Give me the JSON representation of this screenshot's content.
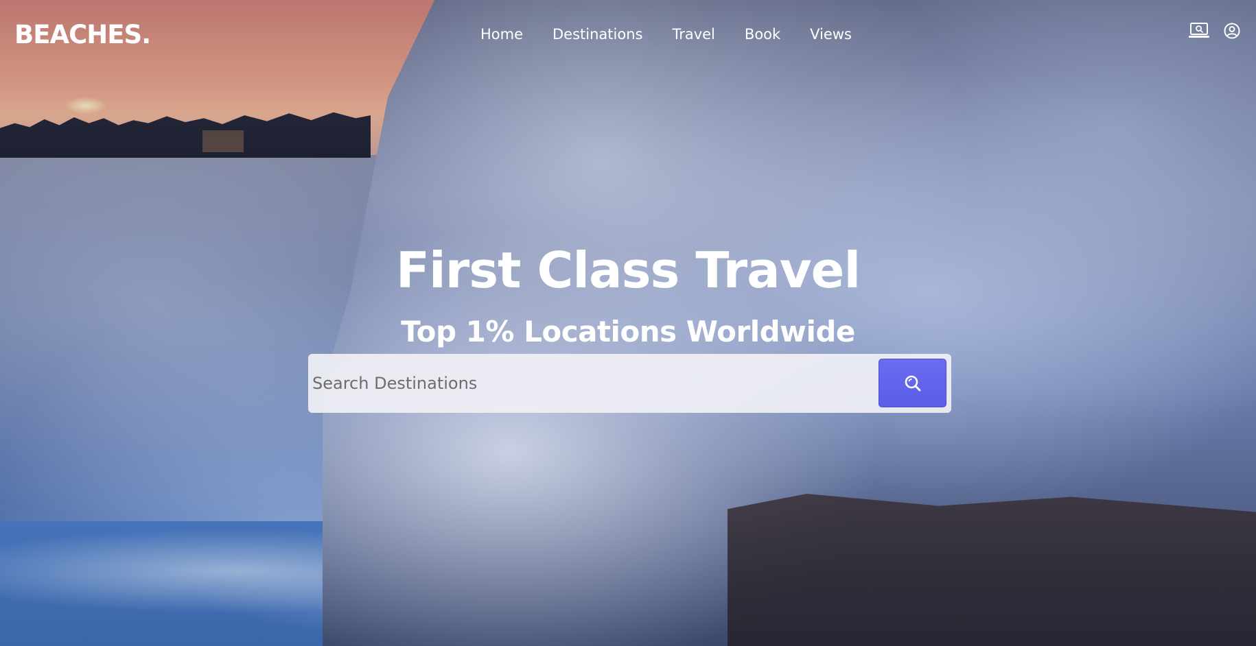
{
  "brand": {
    "logo_text": "BEACHES."
  },
  "nav": {
    "items": [
      {
        "label": "Home"
      },
      {
        "label": "Destinations"
      },
      {
        "label": "Travel"
      },
      {
        "label": "Book"
      },
      {
        "label": "Views"
      }
    ],
    "icons": [
      "laptop-search-icon",
      "user-account-icon"
    ]
  },
  "hero": {
    "title": "First Class Travel",
    "subtitle": "Top 1% Locations Worldwide"
  },
  "search": {
    "placeholder": "Search Destinations",
    "value": "",
    "button_icon": "search-icon"
  },
  "colors": {
    "accent": "#5a5ee8",
    "text": "#ffffff",
    "search_bg": "#f0f0f5"
  }
}
